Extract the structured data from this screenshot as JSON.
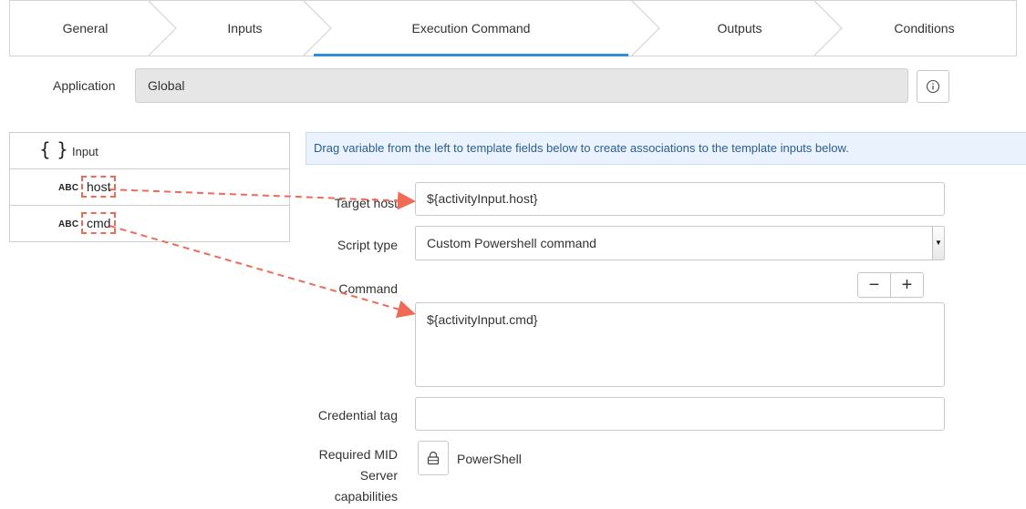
{
  "tabs": [
    {
      "label": "General"
    },
    {
      "label": "Inputs"
    },
    {
      "label": "Execution Command",
      "active": true
    },
    {
      "label": "Outputs"
    },
    {
      "label": "Conditions"
    }
  ],
  "application": {
    "label": "Application",
    "value": "Global"
  },
  "info_icon": "info-icon",
  "variables": {
    "header": {
      "icon": "braces-icon",
      "label": "Input"
    },
    "items": [
      {
        "type_badge": "ABC",
        "name": "host"
      },
      {
        "type_badge": "ABC",
        "name": "cmd"
      }
    ]
  },
  "banner": {
    "text": "Drag variable from the left to template fields below to create associations to the template inputs below."
  },
  "form": {
    "target_host": {
      "label": "Target host",
      "value": "${activityInput.host}"
    },
    "script_type": {
      "label": "Script type",
      "value": "Custom Powershell command"
    },
    "command": {
      "label": "Command",
      "value": "${activityInput.cmd}",
      "minus": "−",
      "plus": "+"
    },
    "credential_tag": {
      "label": "Credential tag",
      "value": ""
    },
    "capabilities": {
      "label_line1": "Required MID",
      "label_line2": "Server",
      "label_line3": "capabilities",
      "value": "PowerShell"
    }
  },
  "colors": {
    "accent": "#2e8fd6",
    "arrow": "#ef6a57",
    "banner_bg": "#eaf3fd",
    "banner_text": "#2b5d8f"
  }
}
